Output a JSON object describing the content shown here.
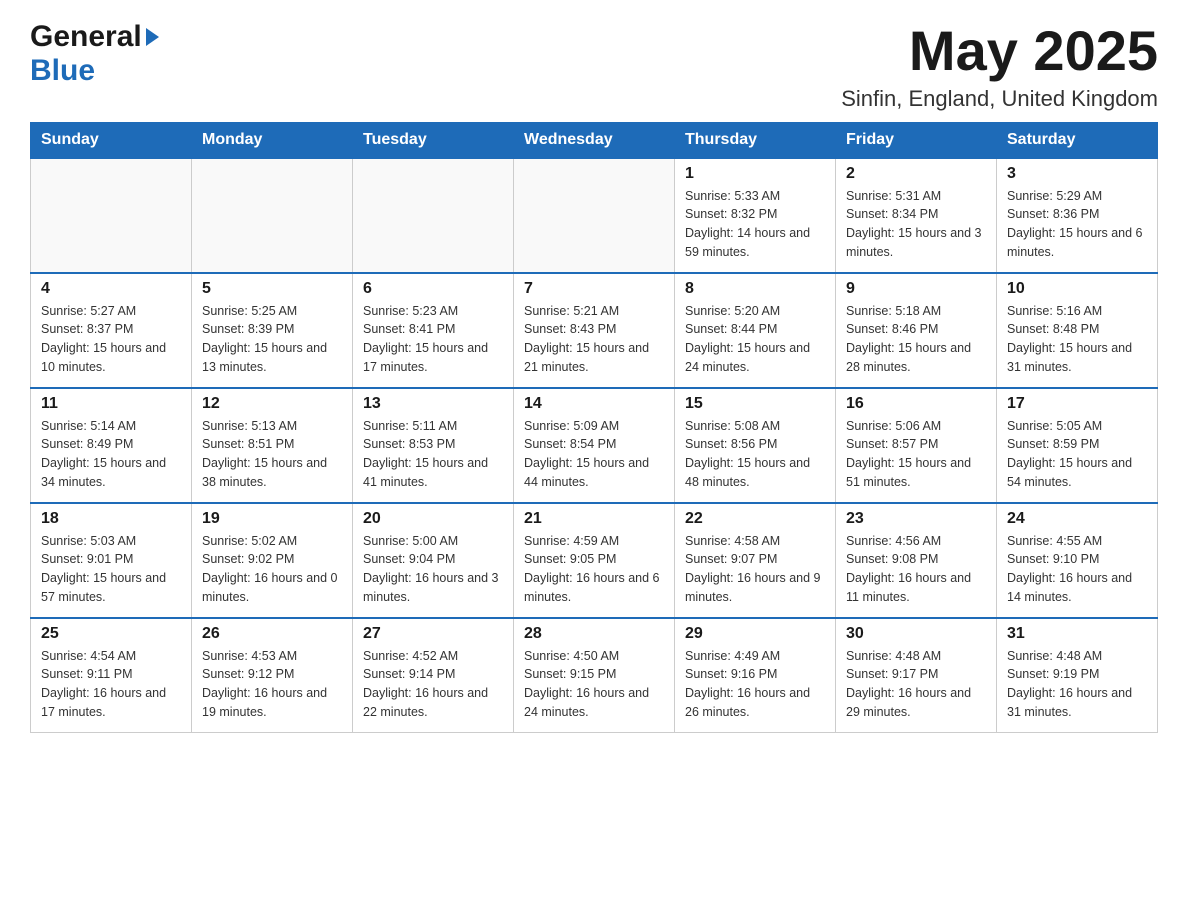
{
  "header": {
    "month_year": "May 2025",
    "location": "Sinfin, England, United Kingdom",
    "logo_general": "General",
    "logo_blue": "Blue"
  },
  "days_of_week": [
    "Sunday",
    "Monday",
    "Tuesday",
    "Wednesday",
    "Thursday",
    "Friday",
    "Saturday"
  ],
  "weeks": [
    [
      {
        "day": "",
        "sunrise": "",
        "sunset": "",
        "daylight": ""
      },
      {
        "day": "",
        "sunrise": "",
        "sunset": "",
        "daylight": ""
      },
      {
        "day": "",
        "sunrise": "",
        "sunset": "",
        "daylight": ""
      },
      {
        "day": "",
        "sunrise": "",
        "sunset": "",
        "daylight": ""
      },
      {
        "day": "1",
        "sunrise": "Sunrise: 5:33 AM",
        "sunset": "Sunset: 8:32 PM",
        "daylight": "Daylight: 14 hours and 59 minutes."
      },
      {
        "day": "2",
        "sunrise": "Sunrise: 5:31 AM",
        "sunset": "Sunset: 8:34 PM",
        "daylight": "Daylight: 15 hours and 3 minutes."
      },
      {
        "day": "3",
        "sunrise": "Sunrise: 5:29 AM",
        "sunset": "Sunset: 8:36 PM",
        "daylight": "Daylight: 15 hours and 6 minutes."
      }
    ],
    [
      {
        "day": "4",
        "sunrise": "Sunrise: 5:27 AM",
        "sunset": "Sunset: 8:37 PM",
        "daylight": "Daylight: 15 hours and 10 minutes."
      },
      {
        "day": "5",
        "sunrise": "Sunrise: 5:25 AM",
        "sunset": "Sunset: 8:39 PM",
        "daylight": "Daylight: 15 hours and 13 minutes."
      },
      {
        "day": "6",
        "sunrise": "Sunrise: 5:23 AM",
        "sunset": "Sunset: 8:41 PM",
        "daylight": "Daylight: 15 hours and 17 minutes."
      },
      {
        "day": "7",
        "sunrise": "Sunrise: 5:21 AM",
        "sunset": "Sunset: 8:43 PM",
        "daylight": "Daylight: 15 hours and 21 minutes."
      },
      {
        "day": "8",
        "sunrise": "Sunrise: 5:20 AM",
        "sunset": "Sunset: 8:44 PM",
        "daylight": "Daylight: 15 hours and 24 minutes."
      },
      {
        "day": "9",
        "sunrise": "Sunrise: 5:18 AM",
        "sunset": "Sunset: 8:46 PM",
        "daylight": "Daylight: 15 hours and 28 minutes."
      },
      {
        "day": "10",
        "sunrise": "Sunrise: 5:16 AM",
        "sunset": "Sunset: 8:48 PM",
        "daylight": "Daylight: 15 hours and 31 minutes."
      }
    ],
    [
      {
        "day": "11",
        "sunrise": "Sunrise: 5:14 AM",
        "sunset": "Sunset: 8:49 PM",
        "daylight": "Daylight: 15 hours and 34 minutes."
      },
      {
        "day": "12",
        "sunrise": "Sunrise: 5:13 AM",
        "sunset": "Sunset: 8:51 PM",
        "daylight": "Daylight: 15 hours and 38 minutes."
      },
      {
        "day": "13",
        "sunrise": "Sunrise: 5:11 AM",
        "sunset": "Sunset: 8:53 PM",
        "daylight": "Daylight: 15 hours and 41 minutes."
      },
      {
        "day": "14",
        "sunrise": "Sunrise: 5:09 AM",
        "sunset": "Sunset: 8:54 PM",
        "daylight": "Daylight: 15 hours and 44 minutes."
      },
      {
        "day": "15",
        "sunrise": "Sunrise: 5:08 AM",
        "sunset": "Sunset: 8:56 PM",
        "daylight": "Daylight: 15 hours and 48 minutes."
      },
      {
        "day": "16",
        "sunrise": "Sunrise: 5:06 AM",
        "sunset": "Sunset: 8:57 PM",
        "daylight": "Daylight: 15 hours and 51 minutes."
      },
      {
        "day": "17",
        "sunrise": "Sunrise: 5:05 AM",
        "sunset": "Sunset: 8:59 PM",
        "daylight": "Daylight: 15 hours and 54 minutes."
      }
    ],
    [
      {
        "day": "18",
        "sunrise": "Sunrise: 5:03 AM",
        "sunset": "Sunset: 9:01 PM",
        "daylight": "Daylight: 15 hours and 57 minutes."
      },
      {
        "day": "19",
        "sunrise": "Sunrise: 5:02 AM",
        "sunset": "Sunset: 9:02 PM",
        "daylight": "Daylight: 16 hours and 0 minutes."
      },
      {
        "day": "20",
        "sunrise": "Sunrise: 5:00 AM",
        "sunset": "Sunset: 9:04 PM",
        "daylight": "Daylight: 16 hours and 3 minutes."
      },
      {
        "day": "21",
        "sunrise": "Sunrise: 4:59 AM",
        "sunset": "Sunset: 9:05 PM",
        "daylight": "Daylight: 16 hours and 6 minutes."
      },
      {
        "day": "22",
        "sunrise": "Sunrise: 4:58 AM",
        "sunset": "Sunset: 9:07 PM",
        "daylight": "Daylight: 16 hours and 9 minutes."
      },
      {
        "day": "23",
        "sunrise": "Sunrise: 4:56 AM",
        "sunset": "Sunset: 9:08 PM",
        "daylight": "Daylight: 16 hours and 11 minutes."
      },
      {
        "day": "24",
        "sunrise": "Sunrise: 4:55 AM",
        "sunset": "Sunset: 9:10 PM",
        "daylight": "Daylight: 16 hours and 14 minutes."
      }
    ],
    [
      {
        "day": "25",
        "sunrise": "Sunrise: 4:54 AM",
        "sunset": "Sunset: 9:11 PM",
        "daylight": "Daylight: 16 hours and 17 minutes."
      },
      {
        "day": "26",
        "sunrise": "Sunrise: 4:53 AM",
        "sunset": "Sunset: 9:12 PM",
        "daylight": "Daylight: 16 hours and 19 minutes."
      },
      {
        "day": "27",
        "sunrise": "Sunrise: 4:52 AM",
        "sunset": "Sunset: 9:14 PM",
        "daylight": "Daylight: 16 hours and 22 minutes."
      },
      {
        "day": "28",
        "sunrise": "Sunrise: 4:50 AM",
        "sunset": "Sunset: 9:15 PM",
        "daylight": "Daylight: 16 hours and 24 minutes."
      },
      {
        "day": "29",
        "sunrise": "Sunrise: 4:49 AM",
        "sunset": "Sunset: 9:16 PM",
        "daylight": "Daylight: 16 hours and 26 minutes."
      },
      {
        "day": "30",
        "sunrise": "Sunrise: 4:48 AM",
        "sunset": "Sunset: 9:17 PM",
        "daylight": "Daylight: 16 hours and 29 minutes."
      },
      {
        "day": "31",
        "sunrise": "Sunrise: 4:48 AM",
        "sunset": "Sunset: 9:19 PM",
        "daylight": "Daylight: 16 hours and 31 minutes."
      }
    ]
  ]
}
